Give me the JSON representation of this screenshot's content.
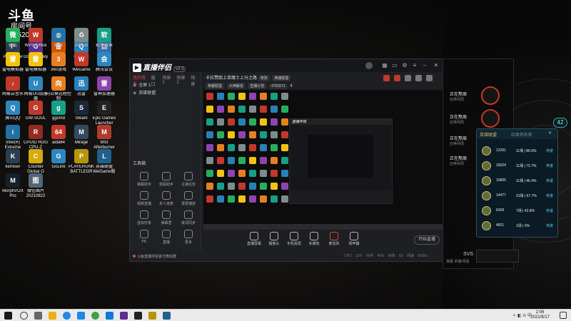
{
  "watermark": {
    "logo": "斗鱼",
    "room_label": "房间号",
    "room_id": "475207"
  },
  "desktop_icons": [
    {
      "label": "PerryFlow",
      "glyph": "P",
      "color": "#2c3e50"
    },
    {
      "label": "GOG Galaxy",
      "glyph": "G",
      "color": "#5b2d8e"
    },
    {
      "label": "鲁大师",
      "glyph": "鲁",
      "color": "#d35400"
    },
    {
      "label": "QQ游戏",
      "glyph": "Q",
      "color": "#2980b9"
    },
    {
      "label": "此电脑",
      "glyph": "▤",
      "color": "#3a6ea5"
    },
    {
      "label": "微信",
      "glyph": "微",
      "color": "#27ae60"
    },
    {
      "label": "WPS Office",
      "glyph": "W",
      "color": "#c0392b"
    },
    {
      "label": "网络",
      "glyph": "◍",
      "color": "#2471a3"
    },
    {
      "label": "回收站",
      "glyph": "♻",
      "color": "#7f8c8d"
    },
    {
      "label": "软件管家",
      "glyph": "软",
      "color": "#16a085"
    },
    {
      "label": "雷电模拟器",
      "glyph": "雷",
      "color": "#f1c40f"
    },
    {
      "label": "雷电模拟器",
      "glyph": "雷",
      "color": "#f1c40f"
    },
    {
      "label": "360游戏",
      "glyph": "3",
      "color": "#e67e22"
    },
    {
      "label": "WeGame",
      "glyph": "W",
      "color": "#c0392b"
    },
    {
      "label": "腾讯会议",
      "glyph": "会",
      "color": "#2e86c1"
    },
    {
      "label": "网易云音乐",
      "glyph": "♪",
      "color": "#c0392b"
    },
    {
      "label": "网易UU加速器",
      "glyph": "U",
      "color": "#2e86c1"
    },
    {
      "label": "向日葵远程控制",
      "glyph": "向",
      "color": "#e67e22"
    },
    {
      "label": "迅雷",
      "glyph": "迅",
      "color": "#2980b9"
    },
    {
      "label": "雷神加速器",
      "glyph": "雷",
      "color": "#8e44ad"
    },
    {
      "label": "腾讯QQ",
      "glyph": "Q",
      "color": "#2e86c1"
    },
    {
      "label": "GW-SOUL",
      "glyph": "G",
      "color": "#c0392b"
    },
    {
      "label": "ggsmd",
      "glyph": "g",
      "color": "#16a085"
    },
    {
      "label": "Steam",
      "glyph": "S",
      "color": "#1b2838"
    },
    {
      "label": "Epic Games Launcher",
      "glyph": "E",
      "color": "#222222"
    },
    {
      "label": "Intel(R) Extreme",
      "glyph": "i",
      "color": "#2471a3"
    },
    {
      "label": "CPUID ROG CPU-Z",
      "glyph": "R",
      "color": "#922b21"
    },
    {
      "label": "aida64",
      "glyph": "64",
      "color": "#c0392b"
    },
    {
      "label": "Mirage",
      "glyph": "M",
      "color": "#34495e"
    },
    {
      "label": "MSI Afterburner",
      "glyph": "M",
      "color": "#b03a2e"
    },
    {
      "label": "kemiser",
      "glyph": "K",
      "color": "#2c3e50"
    },
    {
      "label": "Counter Global O",
      "glyph": "C",
      "color": "#d4ac0d"
    },
    {
      "label": "GoLink",
      "glyph": "G",
      "color": "#2e86c1"
    },
    {
      "label": "PLAYERUNKNOWN BATTLEGR",
      "glyph": "P",
      "color": "#b7950b"
    },
    {
      "label": "英雄联盟 WeGame版",
      "glyph": "L",
      "color": "#1f618d"
    },
    {
      "label": "MorphVOX Pro",
      "glyph": "M",
      "color": "#17202a"
    },
    {
      "label": "微信图片 20210822",
      "glyph": "图",
      "color": "#566573"
    }
  ],
  "app": {
    "name": "直播伴侣",
    "version": "v3.3",
    "scene_tabs": [
      "我的场景",
      "窗口",
      "场景 1",
      "场景 2",
      "场景"
    ],
    "scene_items": [
      "全屏 1",
      "英雄联盟"
    ],
    "tools_label": "工具箱",
    "tools": [
      "弹幕助手",
      "观看助手",
      "主播任务",
      "视频直播",
      "多人连麦",
      "录屏播放",
      "虚拟形象",
      "弹幕君",
      "歌词同步",
      "PK",
      "直播",
      "更多"
    ],
    "bottom_left": "斗鱼直播伴侣官方微信群",
    "stream_title": "卡拉赞跑上单魔士上分之路",
    "edit_label": "修改",
    "category_chip": "英雄联盟",
    "tag_chips": [
      "英雄联盟",
      "大神解说",
      "直播公告",
      "4752071"
    ],
    "counter": "4",
    "bottom_buttons": [
      "直播屏幕",
      "摄像头",
      "手机投屏",
      "多媒体",
      "麦克风",
      "扬声器"
    ],
    "start_live": "开始直播",
    "status": "CPU 11% 内存 45% 帧率 60 网速 0KB/s"
  },
  "right_panel": {
    "rows": [
      {
        "name": "正在熬周",
        "sub": "召唤师周"
      },
      {
        "name": "正在熬周",
        "sub": "召唤师周"
      },
      {
        "name": "正在熬周",
        "sub": "召唤师周"
      },
      {
        "name": "正在熬周",
        "sub": "召唤师周"
      }
    ],
    "footer": "SVS",
    "footer2": "弹幕 单播/观看"
  },
  "rank_overlay": {
    "title": "英雄联盟",
    "search": "召唤师名称",
    "rows": [
      {
        "score": "12391",
        "record": "11场 | 86.6%",
        "detail": "英雄"
      },
      {
        "score": "16624",
        "record": "11场 | 72.7%",
        "detail": "英雄"
      },
      {
        "score": "10805",
        "record": "11场 | 45.4%",
        "detail": "英雄"
      },
      {
        "score": "14477",
        "record": "31场 | 67.7%",
        "detail": "英雄"
      },
      {
        "score": "6428",
        "record": "7场 | 42.8%",
        "detail": "英雄"
      },
      {
        "score": "4821",
        "record": "1场 | 0%",
        "detail": "英雄"
      }
    ],
    "badge": "42"
  },
  "taskbar": {
    "tray_text": "ㅅ ◧ ⊙ 中",
    "time": "2:06",
    "date": "2021/9/17"
  }
}
